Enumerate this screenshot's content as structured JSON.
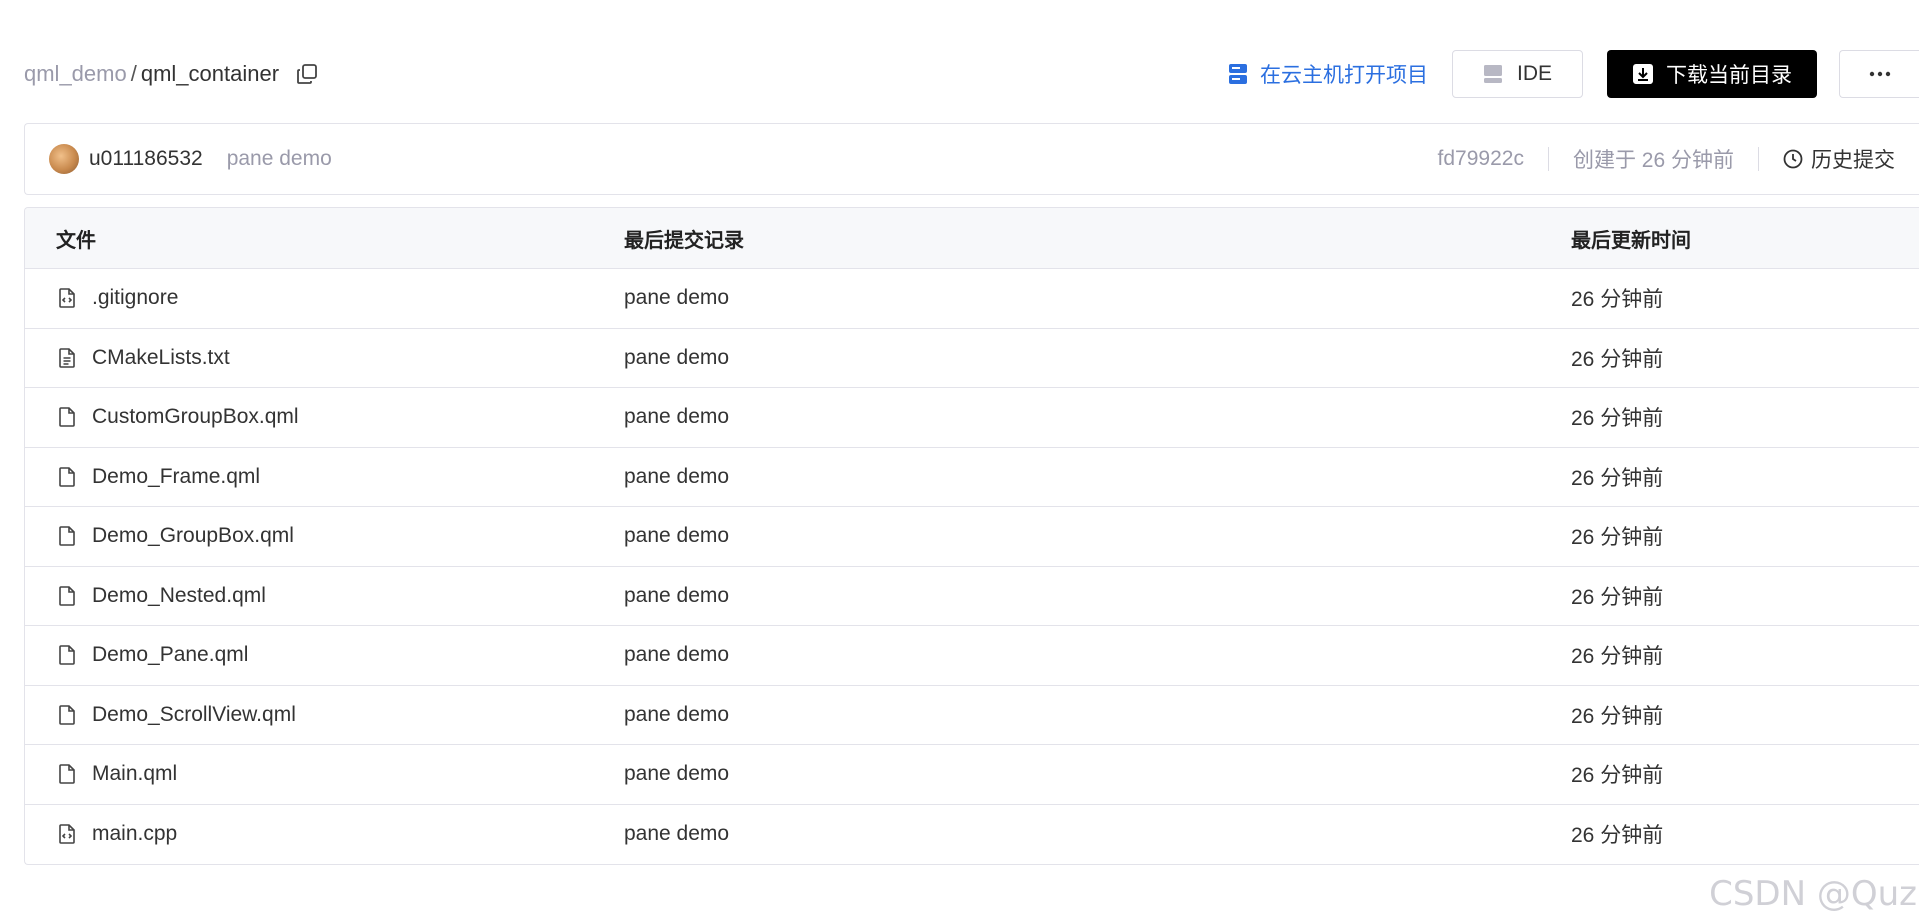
{
  "breadcrumb": {
    "root": "qml_demo",
    "separator": "/",
    "current": "qml_container"
  },
  "actions": {
    "open_cloud_label": "在云主机打开项目",
    "ide_label": "IDE",
    "download_label": "下载当前目录",
    "more_label": "···"
  },
  "commit": {
    "author": "u011186532",
    "message": "pane demo",
    "sha": "fd79922c",
    "created": "创建于 26 分钟前",
    "history_label": "历史提交"
  },
  "table": {
    "headers": {
      "name": "文件",
      "commit": "最后提交记录",
      "time": "最后更新时间"
    },
    "rows": [
      {
        "name": ".gitignore",
        "icon": "code-file-icon",
        "commit": "pane demo",
        "time": "26 分钟前"
      },
      {
        "name": "CMakeLists.txt",
        "icon": "text-file-icon",
        "commit": "pane demo",
        "time": "26 分钟前"
      },
      {
        "name": "CustomGroupBox.qml",
        "icon": "file-icon",
        "commit": "pane demo",
        "time": "26 分钟前"
      },
      {
        "name": "Demo_Frame.qml",
        "icon": "file-icon",
        "commit": "pane demo",
        "time": "26 分钟前"
      },
      {
        "name": "Demo_GroupBox.qml",
        "icon": "file-icon",
        "commit": "pane demo",
        "time": "26 分钟前"
      },
      {
        "name": "Demo_Nested.qml",
        "icon": "file-icon",
        "commit": "pane demo",
        "time": "26 分钟前"
      },
      {
        "name": "Demo_Pane.qml",
        "icon": "file-icon",
        "commit": "pane demo",
        "time": "26 分钟前"
      },
      {
        "name": "Demo_ScrollView.qml",
        "icon": "file-icon",
        "commit": "pane demo",
        "time": "26 分钟前"
      },
      {
        "name": "Main.qml",
        "icon": "file-icon",
        "commit": "pane demo",
        "time": "26 分钟前"
      },
      {
        "name": "main.cpp",
        "icon": "code-file-icon",
        "commit": "pane demo",
        "time": "26 分钟前"
      }
    ]
  },
  "watermark": "CSDN @Quz",
  "colors": {
    "accent": "#2b6fe0",
    "download_bg": "#000000",
    "muted": "#9a9aaa"
  }
}
